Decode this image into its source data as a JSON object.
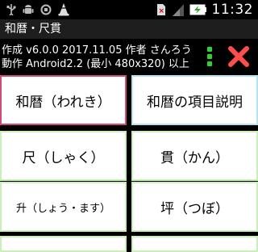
{
  "status": {
    "time": "11:32",
    "left_icons": [
      "usb-icon",
      "android-debug-icon",
      "sync-icon",
      "vlc-cone-icon"
    ],
    "right_icons": [
      "sim-error-icon",
      "signal-icon",
      "battery-charging-icon"
    ]
  },
  "app": {
    "title": "和暦・尺貫"
  },
  "info": {
    "line1": "作成 v6.0.0 2017.11.05 作者 さんろう",
    "line2": "動作 Android2.2 (最小 480x320) 以上"
  },
  "menu": {
    "items": [
      {
        "label": "和暦（われき）"
      },
      {
        "label": "和暦の項目説明"
      },
      {
        "label": "尺（しゃく）"
      },
      {
        "label": "貫（かん）"
      },
      {
        "label": "升（しょう・ます）"
      },
      {
        "label": "坪（つぼ）"
      }
    ]
  },
  "colors": {
    "selected_border": "#d14b7a",
    "normal_border": "#c8f0b8",
    "cyan_border": "#b7e2f0",
    "close_icon": "#ff4d4d",
    "dots_icon": "#2ed12e"
  }
}
